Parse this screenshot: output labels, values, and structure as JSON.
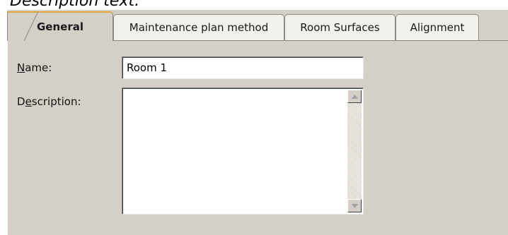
{
  "caption": "Description text.",
  "tabs": [
    {
      "label": "General",
      "active": true
    },
    {
      "label": "Maintenance plan method",
      "active": false
    },
    {
      "label": "Room Surfaces",
      "active": false
    },
    {
      "label": "Alignment",
      "active": false
    }
  ],
  "form": {
    "name_label_mnemonic": "N",
    "name_label_rest": "ame:",
    "name_value": "Room 1",
    "description_label_prefix": "D",
    "description_label_mnemonic": "e",
    "description_label_rest": "scription:",
    "description_value": ""
  },
  "icons": {
    "scroll_up": "triangle-up-icon",
    "scroll_down": "triangle-down-icon"
  },
  "colors": {
    "dialog_bg": "#d4d0c8",
    "active_tab_accent": "#e6a33a"
  }
}
